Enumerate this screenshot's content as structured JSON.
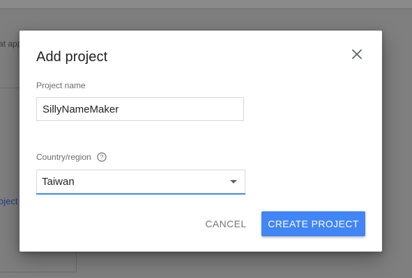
{
  "background": {
    "snippet_text": "at app",
    "link_text": "oject"
  },
  "dialog": {
    "title": "Add project",
    "close_icon": "close-icon",
    "project_name": {
      "label": "Project name",
      "value": "SillyNameMaker"
    },
    "country_region": {
      "label": "Country/region",
      "help_icon": "help-icon",
      "selected_value": "Taiwan",
      "dropdown_icon": "chevron-down-icon"
    },
    "actions": {
      "cancel_label": "CANCEL",
      "create_label": "CREATE PROJECT"
    }
  },
  "colors": {
    "primary": "#4285f4",
    "overlay": "#7f7f7f",
    "dialog_bg": "#ffffff",
    "text_primary": "#212121",
    "text_secondary": "#6b6b6b"
  }
}
